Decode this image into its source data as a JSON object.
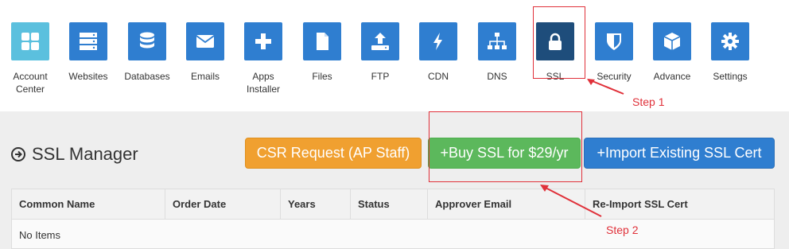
{
  "toolbar": {
    "items": [
      {
        "label1": "Account",
        "label2": "Center",
        "icon": "grid-icon",
        "color": "#5bc0de"
      },
      {
        "label1": "Websites",
        "label2": "",
        "icon": "server-icon",
        "color": "#2f7ed0"
      },
      {
        "label1": "Databases",
        "label2": "",
        "icon": "database-icon",
        "color": "#2f7ed0"
      },
      {
        "label1": "Emails",
        "label2": "",
        "icon": "envelope-icon",
        "color": "#2f7ed0"
      },
      {
        "label1": "Apps",
        "label2": "Installer",
        "icon": "plus-icon",
        "color": "#2f7ed0"
      },
      {
        "label1": "Files",
        "label2": "",
        "icon": "file-icon",
        "color": "#2f7ed0"
      },
      {
        "label1": "FTP",
        "label2": "",
        "icon": "upload-icon",
        "color": "#2f7ed0"
      },
      {
        "label1": "CDN",
        "label2": "",
        "icon": "bolt-icon",
        "color": "#2f7ed0"
      },
      {
        "label1": "DNS",
        "label2": "",
        "icon": "sitemap-icon",
        "color": "#2f7ed0"
      },
      {
        "label1": "SSL",
        "label2": "",
        "icon": "lock-icon",
        "color": "#1e4d7b"
      },
      {
        "label1": "Security",
        "label2": "",
        "icon": "shield-icon",
        "color": "#2f7ed0"
      },
      {
        "label1": "Advance",
        "label2": "",
        "icon": "cube-icon",
        "color": "#2f7ed0"
      },
      {
        "label1": "Settings",
        "label2": "",
        "icon": "gear-icon",
        "color": "#2f7ed0"
      }
    ]
  },
  "page": {
    "title": "SSL Manager"
  },
  "buttons": {
    "csr": "CSR Request (AP Staff)",
    "buy": "+Buy SSL for $29/yr",
    "import": "+Import Existing SSL Cert"
  },
  "table": {
    "headers": [
      "Common Name",
      "Order Date",
      "Years",
      "Status",
      "Approver Email",
      "Re-Import SSL Cert"
    ],
    "empty": "No Items"
  },
  "annotations": {
    "step1": "Step 1",
    "step2": "Step 2"
  },
  "colors": {
    "highlight": "#e0313a",
    "orange": "#f0a030",
    "green": "#5cb85c",
    "blue": "#2f7ed0"
  }
}
